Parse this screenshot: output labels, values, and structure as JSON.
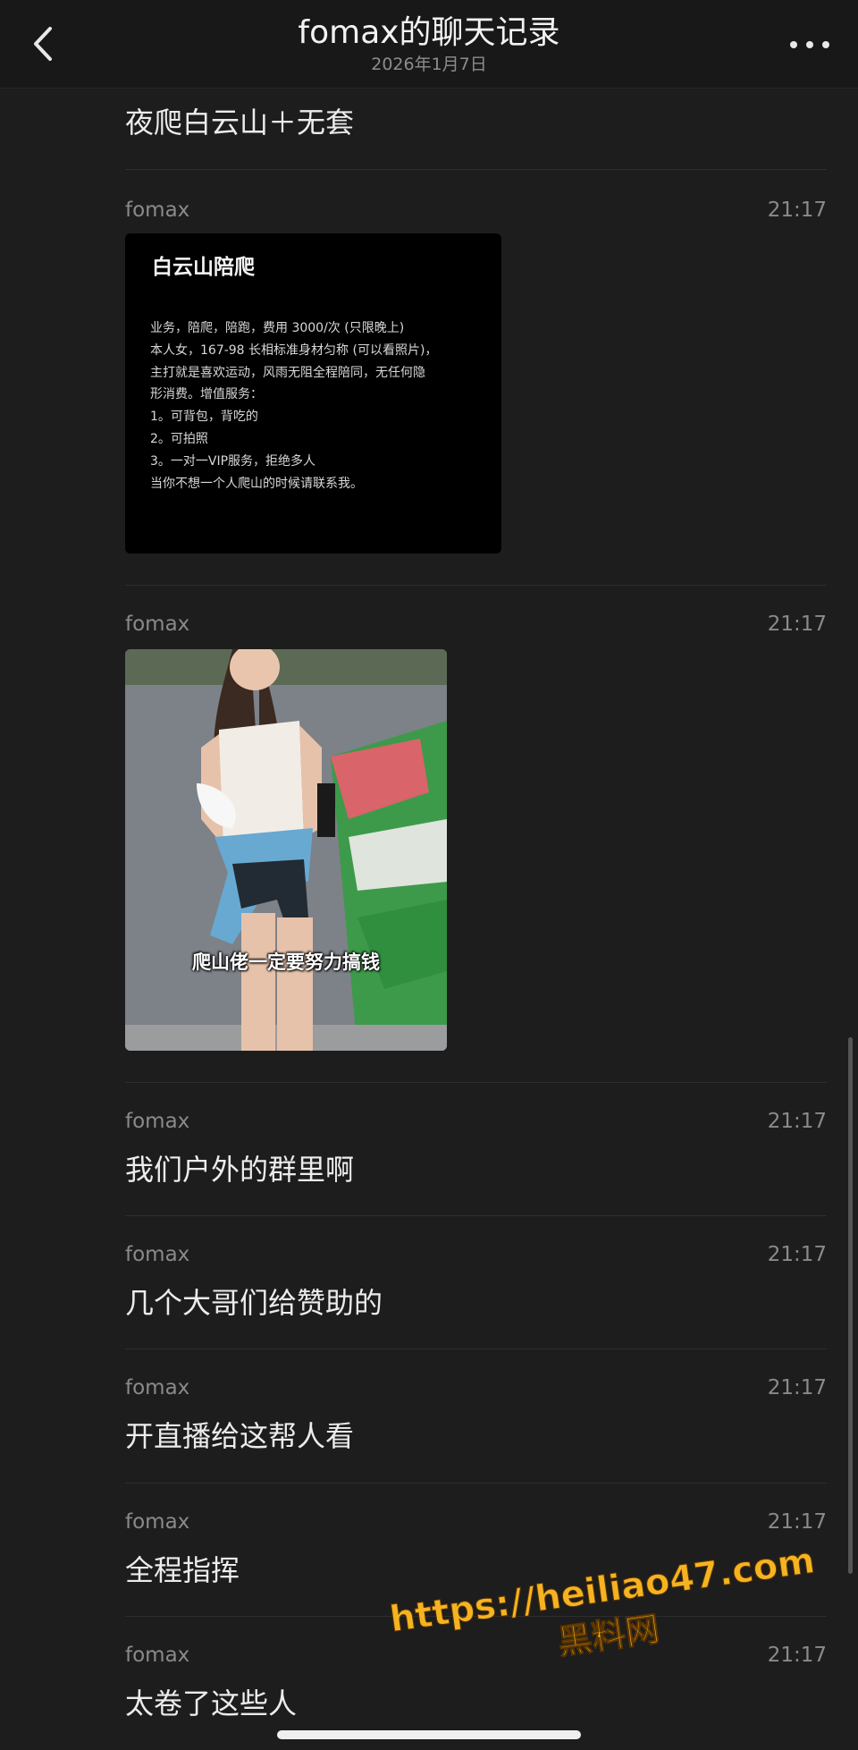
{
  "header": {
    "title": "fomax的聊天记录",
    "subtitle": "2026年1月7日"
  },
  "messages": [
    {
      "type": "text",
      "text": "夜爬白云山＋无套"
    },
    {
      "type": "card",
      "sender": "fomax",
      "time": "21:17",
      "card": {
        "title": "白云山陪爬",
        "lines": [
          "业务，陪爬，陪跑，费用 3000/次 (只限晚上)",
          "本人女，167-98 长相标准身材匀称 (可以看照片)，",
          "主打就是喜欢运动，风雨无阻全程陪同，无任何隐",
          "形消费。增值服务：",
          "1。可背包，背吃的",
          "2。可拍照",
          "3。一对一VIP服务，拒绝多人",
          "当你不想一个人爬山的时候请联系我。"
        ]
      }
    },
    {
      "type": "image",
      "sender": "fomax",
      "time": "21:17",
      "caption": "爬山佬一定要努力搞钱"
    },
    {
      "type": "text",
      "sender": "fomax",
      "time": "21:17",
      "text": "我们户外的群里啊"
    },
    {
      "type": "text",
      "sender": "fomax",
      "time": "21:17",
      "text": "几个大哥们给赞助的"
    },
    {
      "type": "text",
      "sender": "fomax",
      "time": "21:17",
      "text": "开直播给这帮人看"
    },
    {
      "type": "text",
      "sender": "fomax",
      "time": "21:17",
      "text": "全程指挥"
    },
    {
      "type": "text",
      "sender": "fomax",
      "time": "21:17",
      "text": "太卷了这些人"
    }
  ],
  "watermark": {
    "url": "https://heiliao47.com",
    "name": "黑料网"
  },
  "colors": {
    "background": "#1d1d1d",
    "watermark": "#f5b321"
  }
}
